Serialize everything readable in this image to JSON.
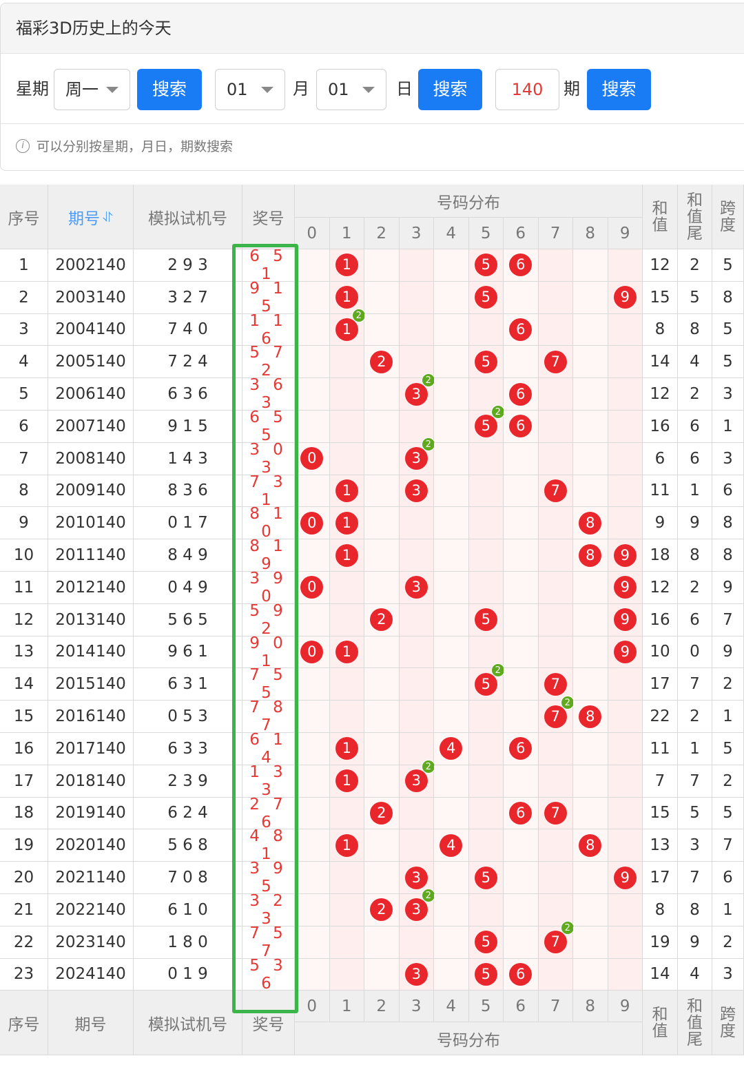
{
  "panel": {
    "title": "福彩3D历史上的今天",
    "weekday_label": "星期",
    "weekday_value": "周一",
    "search_label": "搜索",
    "month_value": "01",
    "month_label": "月",
    "day_value": "01",
    "day_label": "日",
    "period_value": "140",
    "period_label": "期",
    "tip": "可以分别按星期，月日，期数搜索"
  },
  "table": {
    "headers": {
      "index": "序号",
      "period": "期号",
      "sort_icon": "⥯",
      "trial": "模拟试机号",
      "prize": "奖号",
      "distribution": "号码分布",
      "digits": [
        "0",
        "1",
        "2",
        "3",
        "4",
        "5",
        "6",
        "7",
        "8",
        "9"
      ],
      "sum": "和值",
      "sum_tail": "和值尾",
      "span": "跨度"
    },
    "rows": [
      {
        "idx": "1",
        "period": "2002140",
        "trial": "2 9 3",
        "prize": "6 5 1",
        "n": [
          6,
          5,
          1
        ],
        "sum": "12",
        "tail": "2",
        "span": "5"
      },
      {
        "idx": "2",
        "period": "2003140",
        "trial": "3 2 7",
        "prize": "9 1 5",
        "n": [
          9,
          1,
          5
        ],
        "sum": "15",
        "tail": "5",
        "span": "8"
      },
      {
        "idx": "3",
        "period": "2004140",
        "trial": "7 4 0",
        "prize": "1 1 6",
        "n": [
          1,
          1,
          6
        ],
        "sum": "8",
        "tail": "8",
        "span": "5"
      },
      {
        "idx": "4",
        "period": "2005140",
        "trial": "7 2 4",
        "prize": "5 7 2",
        "n": [
          5,
          7,
          2
        ],
        "sum": "14",
        "tail": "4",
        "span": "5"
      },
      {
        "idx": "5",
        "period": "2006140",
        "trial": "6 3 6",
        "prize": "3 6 3",
        "n": [
          3,
          6,
          3
        ],
        "sum": "12",
        "tail": "2",
        "span": "3"
      },
      {
        "idx": "6",
        "period": "2007140",
        "trial": "9 1 5",
        "prize": "6 5 5",
        "n": [
          6,
          5,
          5
        ],
        "sum": "16",
        "tail": "6",
        "span": "1"
      },
      {
        "idx": "7",
        "period": "2008140",
        "trial": "1 4 3",
        "prize": "3 0 3",
        "n": [
          3,
          0,
          3
        ],
        "sum": "6",
        "tail": "6",
        "span": "3"
      },
      {
        "idx": "8",
        "period": "2009140",
        "trial": "8 3 6",
        "prize": "7 3 1",
        "n": [
          7,
          3,
          1
        ],
        "sum": "11",
        "tail": "1",
        "span": "6"
      },
      {
        "idx": "9",
        "period": "2010140",
        "trial": "0 1 7",
        "prize": "8 1 0",
        "n": [
          8,
          1,
          0
        ],
        "sum": "9",
        "tail": "9",
        "span": "8"
      },
      {
        "idx": "10",
        "period": "2011140",
        "trial": "8 4 9",
        "prize": "8 1 9",
        "n": [
          8,
          1,
          9
        ],
        "sum": "18",
        "tail": "8",
        "span": "8"
      },
      {
        "idx": "11",
        "period": "2012140",
        "trial": "0 4 9",
        "prize": "3 9 0",
        "n": [
          3,
          9,
          0
        ],
        "sum": "12",
        "tail": "2",
        "span": "9"
      },
      {
        "idx": "12",
        "period": "2013140",
        "trial": "5 6 5",
        "prize": "5 9 2",
        "n": [
          5,
          9,
          2
        ],
        "sum": "16",
        "tail": "6",
        "span": "7"
      },
      {
        "idx": "13",
        "period": "2014140",
        "trial": "9 6 1",
        "prize": "9 0 1",
        "n": [
          9,
          0,
          1
        ],
        "sum": "10",
        "tail": "0",
        "span": "9"
      },
      {
        "idx": "14",
        "period": "2015140",
        "trial": "6 3 1",
        "prize": "7 5 5",
        "n": [
          7,
          5,
          5
        ],
        "sum": "17",
        "tail": "7",
        "span": "2"
      },
      {
        "idx": "15",
        "period": "2016140",
        "trial": "0 5 3",
        "prize": "7 8 7",
        "n": [
          7,
          8,
          7
        ],
        "sum": "22",
        "tail": "2",
        "span": "1"
      },
      {
        "idx": "16",
        "period": "2017140",
        "trial": "6 3 3",
        "prize": "6 1 4",
        "n": [
          6,
          1,
          4
        ],
        "sum": "11",
        "tail": "1",
        "span": "5"
      },
      {
        "idx": "17",
        "period": "2018140",
        "trial": "2 3 9",
        "prize": "1 3 3",
        "n": [
          1,
          3,
          3
        ],
        "sum": "7",
        "tail": "7",
        "span": "2"
      },
      {
        "idx": "18",
        "period": "2019140",
        "trial": "6 2 4",
        "prize": "2 7 6",
        "n": [
          2,
          7,
          6
        ],
        "sum": "15",
        "tail": "5",
        "span": "5"
      },
      {
        "idx": "19",
        "period": "2020140",
        "trial": "5 6 8",
        "prize": "4 8 1",
        "n": [
          4,
          8,
          1
        ],
        "sum": "13",
        "tail": "3",
        "span": "7"
      },
      {
        "idx": "20",
        "period": "2021140",
        "trial": "7 0 8",
        "prize": "3 9 5",
        "n": [
          3,
          9,
          5
        ],
        "sum": "17",
        "tail": "7",
        "span": "6"
      },
      {
        "idx": "21",
        "period": "2022140",
        "trial": "6 1 0",
        "prize": "3 2 3",
        "n": [
          3,
          2,
          3
        ],
        "sum": "8",
        "tail": "8",
        "span": "1"
      },
      {
        "idx": "22",
        "period": "2023140",
        "trial": "1 8 0",
        "prize": "7 5 7",
        "n": [
          7,
          5,
          7
        ],
        "sum": "19",
        "tail": "9",
        "span": "2"
      },
      {
        "idx": "23",
        "period": "2024140",
        "trial": "0 1 9",
        "prize": "5 3 6",
        "n": [
          5,
          3,
          6
        ],
        "sum": "14",
        "tail": "4",
        "span": "3"
      }
    ]
  },
  "colors": {
    "accent": "#1a7cf5",
    "ball": "#e8262c",
    "repeat_badge": "#5ea91e",
    "highlight_box": "#3bb54a",
    "prize_text": "#e53935"
  }
}
